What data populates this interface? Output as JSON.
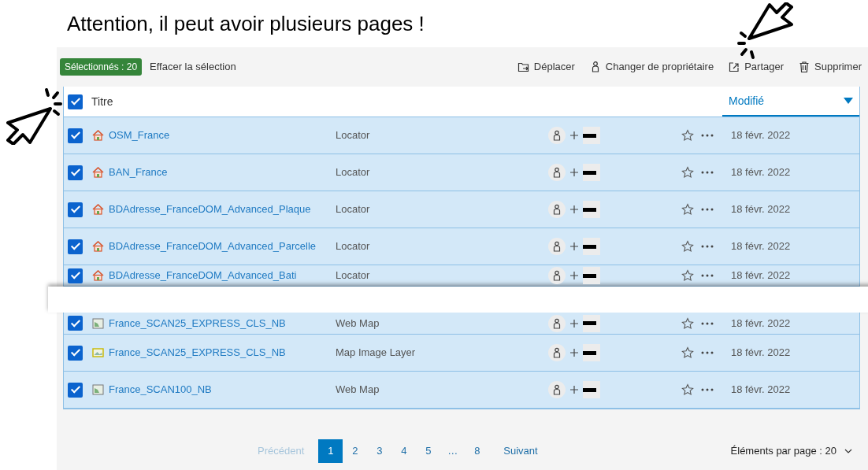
{
  "annotation": {
    "title": "Attention, il peut avoir plusieurs pages !"
  },
  "toolbar": {
    "selected_badge": "Sélectionnés : 20",
    "clear_link": "Effacer la sélection",
    "actions": [
      {
        "kind": "move",
        "label": "Déplacer"
      },
      {
        "kind": "owner",
        "label": "Changer de propriétaire"
      },
      {
        "kind": "share",
        "label": "Partager"
      },
      {
        "kind": "delete",
        "label": "Supprimer"
      }
    ]
  },
  "table": {
    "select_all_checked": true,
    "columns": [
      {
        "label": "Titre",
        "sorted": false
      },
      {
        "label": "Modifié",
        "sorted": true
      }
    ],
    "sections": [
      {
        "rows": [
          {
            "kind": "locator",
            "title": "OSM_France",
            "type": "Locator",
            "date": "18 févr. 2022",
            "checked": true
          },
          {
            "kind": "locator",
            "title": "BAN_France",
            "type": "Locator",
            "date": "18 févr. 2022",
            "checked": true
          },
          {
            "kind": "locator",
            "title": "BDAdresse_FranceDOM_Advanced_Plaque",
            "type": "Locator",
            "date": "18 févr. 2022",
            "checked": true
          },
          {
            "kind": "locator",
            "title": "BDAdresse_FranceDOM_Advanced_Parcelle",
            "type": "Locator",
            "date": "18 févr. 2022",
            "checked": true
          },
          {
            "kind": "locator",
            "title": "BDAdresse_FranceDOM_Advanced_Bati",
            "type": "Locator",
            "date": "18 févr. 2022",
            "checked": true
          }
        ]
      },
      {
        "rows": [
          {
            "kind": "web_map",
            "title": "France_SCAN25_EXPRESS_CLS_NB",
            "type": "Web Map",
            "date": "18 févr. 2022",
            "checked": true
          },
          {
            "kind": "map_image",
            "title": "France_SCAN25_EXPRESS_CLS_NB",
            "type": "Map Image Layer",
            "date": "18 févr. 2022",
            "checked": true
          },
          {
            "kind": "web_map",
            "title": "France_SCAN100_NB",
            "type": "Web Map",
            "date": "18 févr. 2022",
            "checked": true
          }
        ]
      }
    ]
  },
  "pagination": {
    "previous": {
      "label": "Précédent",
      "disabled": true
    },
    "pages": [
      {
        "label": "1",
        "selected": true
      },
      {
        "label": "2",
        "selected": false
      },
      {
        "label": "3",
        "selected": false
      },
      {
        "label": "4",
        "selected": false
      },
      {
        "label": "5",
        "selected": false
      },
      {
        "label": "…",
        "selected": false
      },
      {
        "label": "8",
        "selected": false
      }
    ],
    "next": {
      "label": "Suivant",
      "disabled": false
    },
    "per_page": "Éléments par page : 20"
  }
}
